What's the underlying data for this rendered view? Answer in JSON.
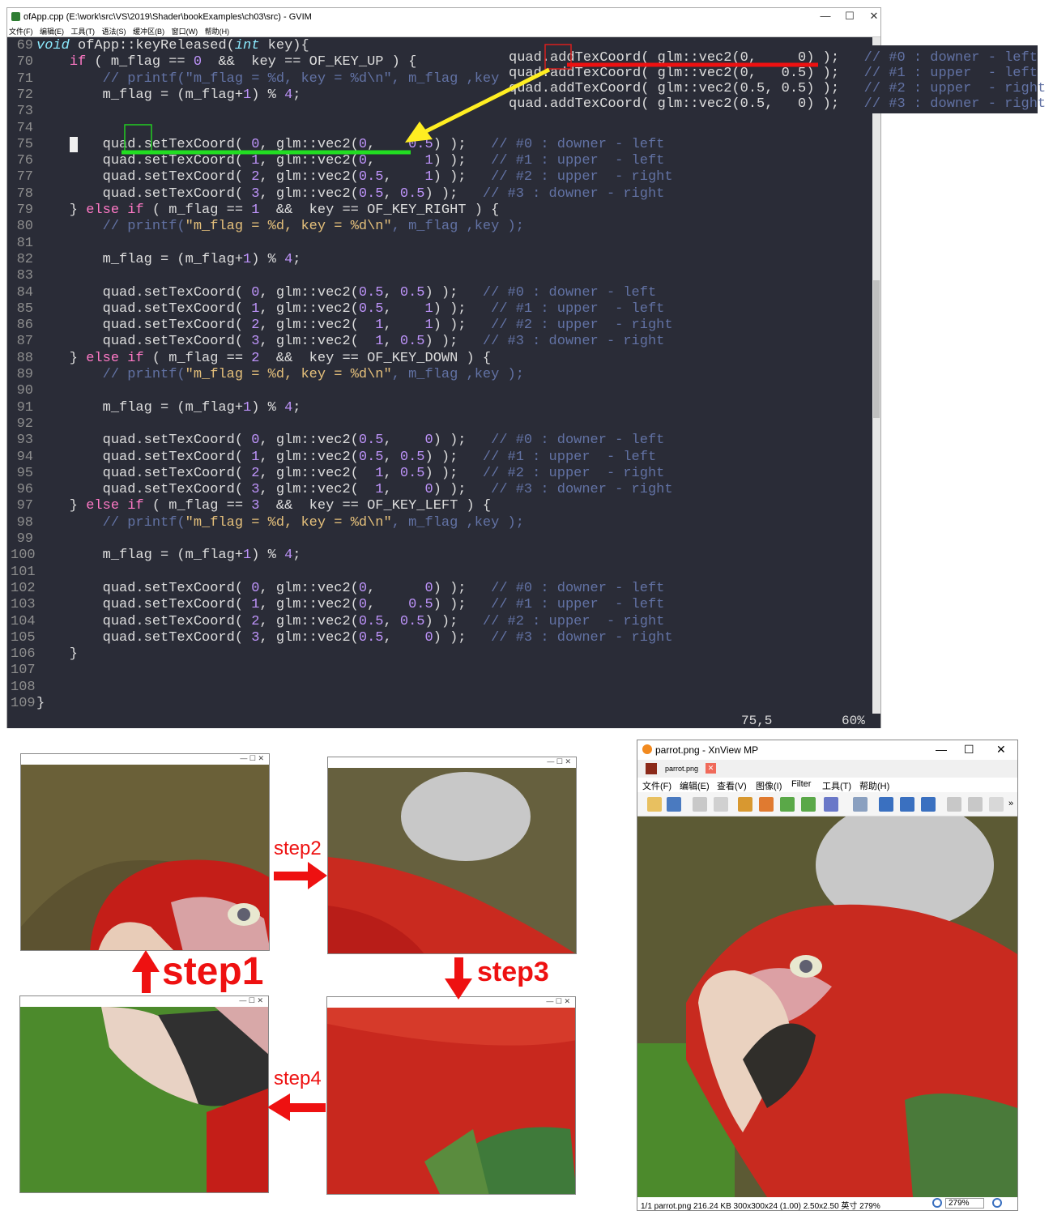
{
  "gvim": {
    "title": "ofApp.cpp (E:\\work\\src\\VS\\2019\\Shader\\bookExamples\\ch03\\src) - GVIM",
    "menu": [
      "文件(F)",
      "编辑(E)",
      "工具(T)",
      "语法(S)",
      "缓冲区(B)",
      "窗口(W)",
      "帮助(H)"
    ],
    "status_pos": "75,5",
    "status_pct": "60%",
    "window_controls": [
      "minimize-icon",
      "maximize-icon",
      "close-icon"
    ],
    "code": [
      {
        "n": "69",
        "h": "<span class='t'>void</span> ofApp::keyReleased(<span class='t'>int</span> key){"
      },
      {
        "n": "70",
        "h": "    <span class='k'>if</span> ( m_flag == <span class='n'>0</span>  &&  key == OF_KEY_UP ) {"
      },
      {
        "n": "71",
        "h": "        <span class='c'>// printf(\"m_flag = %d, key = %d\\n\", m_flag ,key );</span>"
      },
      {
        "n": "72",
        "h": "        m_flag = (m_flag+<span class='n'>1</span>) % <span class='n'>4</span>;"
      },
      {
        "n": "73",
        "h": ""
      },
      {
        "n": "74",
        "h": ""
      },
      {
        "n": "75",
        "h": "    <span style='background:#f0f0f0'> </span>   quad.setTexCoord( <span class='n'>0</span>, glm::vec2(<span class='n'>0</span>,    <span class='n'>0.5</span>) );   <span class='c'>// #0 : downer - left</span>"
      },
      {
        "n": "76",
        "h": "        quad.setTexCoord( <span class='n'>1</span>, glm::vec2(<span class='n'>0</span>,      <span class='n'>1</span>) );   <span class='c'>// #1 : upper  - left</span>"
      },
      {
        "n": "77",
        "h": "        quad.setTexCoord( <span class='n'>2</span>, glm::vec2(<span class='n'>0.5</span>,    <span class='n'>1</span>) );   <span class='c'>// #2 : upper  - right</span>"
      },
      {
        "n": "78",
        "h": "        quad.setTexCoord( <span class='n'>3</span>, glm::vec2(<span class='n'>0.5</span>, <span class='n'>0.5</span>) );   <span class='c'>// #3 : downer - right</span>"
      },
      {
        "n": "79",
        "h": "    } <span class='k'>else if</span> ( m_flag == <span class='n'>1</span>  &&  key == OF_KEY_RIGHT ) {"
      },
      {
        "n": "80",
        "h": "        <span class='c'>// printf(</span><span class='s'>\"m_flag = %d, key = %d\\n\"</span><span class='c'>, m_flag ,key );</span>"
      },
      {
        "n": "81",
        "h": ""
      },
      {
        "n": "82",
        "h": "        m_flag = (m_flag+<span class='n'>1</span>) % <span class='n'>4</span>;"
      },
      {
        "n": "83",
        "h": ""
      },
      {
        "n": "84",
        "h": "        quad.setTexCoord( <span class='n'>0</span>, glm::vec2(<span class='n'>0.5</span>, <span class='n'>0.5</span>) );   <span class='c'>// #0 : downer - left</span>"
      },
      {
        "n": "85",
        "h": "        quad.setTexCoord( <span class='n'>1</span>, glm::vec2(<span class='n'>0.5</span>,    <span class='n'>1</span>) );   <span class='c'>// #1 : upper  - left</span>"
      },
      {
        "n": "86",
        "h": "        quad.setTexCoord( <span class='n'>2</span>, glm::vec2(  <span class='n'>1</span>,    <span class='n'>1</span>) );   <span class='c'>// #2 : upper  - right</span>"
      },
      {
        "n": "87",
        "h": "        quad.setTexCoord( <span class='n'>3</span>, glm::vec2(  <span class='n'>1</span>, <span class='n'>0.5</span>) );   <span class='c'>// #3 : downer - right</span>"
      },
      {
        "n": "88",
        "h": "    } <span class='k'>else if</span> ( m_flag == <span class='n'>2</span>  &&  key == OF_KEY_DOWN ) {"
      },
      {
        "n": "89",
        "h": "        <span class='c'>// printf(</span><span class='s'>\"m_flag = %d, key = %d\\n\"</span><span class='c'>, m_flag ,key );</span>"
      },
      {
        "n": "90",
        "h": ""
      },
      {
        "n": "91",
        "h": "        m_flag = (m_flag+<span class='n'>1</span>) % <span class='n'>4</span>;"
      },
      {
        "n": "92",
        "h": ""
      },
      {
        "n": "93",
        "h": "        quad.setTexCoord( <span class='n'>0</span>, glm::vec2(<span class='n'>0.5</span>,    <span class='n'>0</span>) );   <span class='c'>// #0 : downer - left</span>"
      },
      {
        "n": "94",
        "h": "        quad.setTexCoord( <span class='n'>1</span>, glm::vec2(<span class='n'>0.5</span>, <span class='n'>0.5</span>) );   <span class='c'>// #1 : upper  - left</span>"
      },
      {
        "n": "95",
        "h": "        quad.setTexCoord( <span class='n'>2</span>, glm::vec2(  <span class='n'>1</span>, <span class='n'>0.5</span>) );   <span class='c'>// #2 : upper  - right</span>"
      },
      {
        "n": "96",
        "h": "        quad.setTexCoord( <span class='n'>3</span>, glm::vec2(  <span class='n'>1</span>,    <span class='n'>0</span>) );   <span class='c'>// #3 : downer - right</span>"
      },
      {
        "n": "97",
        "h": "    } <span class='k'>else if</span> ( m_flag == <span class='n'>3</span>  &&  key == OF_KEY_LEFT ) {"
      },
      {
        "n": "98",
        "h": "        <span class='c'>// printf(</span><span class='s'>\"m_flag = %d, key = %d\\n\"</span><span class='c'>, m_flag ,key );</span>"
      },
      {
        "n": "99",
        "h": ""
      },
      {
        "n": "100",
        "h": "        m_flag = (m_flag+<span class='n'>1</span>) % <span class='n'>4</span>;"
      },
      {
        "n": "101",
        "h": ""
      },
      {
        "n": "102",
        "h": "        quad.setTexCoord( <span class='n'>0</span>, glm::vec2(<span class='n'>0</span>,      <span class='n'>0</span>) );   <span class='c'>// #0 : downer - left</span>"
      },
      {
        "n": "103",
        "h": "        quad.setTexCoord( <span class='n'>1</span>, glm::vec2(<span class='n'>0</span>,    <span class='n'>0.5</span>) );   <span class='c'>// #1 : upper  - left</span>"
      },
      {
        "n": "104",
        "h": "        quad.setTexCoord( <span class='n'>2</span>, glm::vec2(<span class='n'>0.5</span>, <span class='n'>0.5</span>) );   <span class='c'>// #2 : upper  - right</span>"
      },
      {
        "n": "105",
        "h": "        quad.setTexCoord( <span class='n'>3</span>, glm::vec2(<span class='n'>0.5</span>,    <span class='n'>0</span>) );   <span class='c'>// #3 : downer - right</span>"
      },
      {
        "n": "106",
        "h": "    }"
      },
      {
        "n": "107",
        "h": ""
      },
      {
        "n": "108",
        "h": ""
      },
      {
        "n": "109",
        "h": "}"
      }
    ],
    "inset": [
      "quad.addTexCoord( glm::vec2(0,     0) );   <span class='c'>// #0 : downer - left</span>",
      "quad.addTexCoord( glm::vec2(0,   0.5) );   <span class='c'>// #1 : upper  - left</span>",
      "quad.addTexCoord( glm::vec2(0.5, 0.5) );   <span class='c'>// #2 : upper  - right</span>",
      "quad.addTexCoord( glm::vec2(0.5,   0) );   <span class='c'>// #3 : downer - right</span>"
    ]
  },
  "steps": [
    "step1",
    "step2",
    "step3",
    "step4"
  ],
  "xnview": {
    "title": "parrot.png - XnView MP",
    "tab": "parrot.png",
    "menu": [
      "文件(F)",
      "编辑(E)",
      "查看(V)",
      "图像(I)",
      "Filter",
      "工具(T)",
      "帮助(H)"
    ],
    "status": "1/1  parrot.png  216.24 KB  300x300x24 (1.00)  2.50x2.50 英寸  279%",
    "zoom": "279%",
    "overflow": "»"
  },
  "colors": {
    "red": "#ee1111",
    "green": "#22dd22",
    "yellow": "#ffee22",
    "bg": "#2a2c37"
  }
}
